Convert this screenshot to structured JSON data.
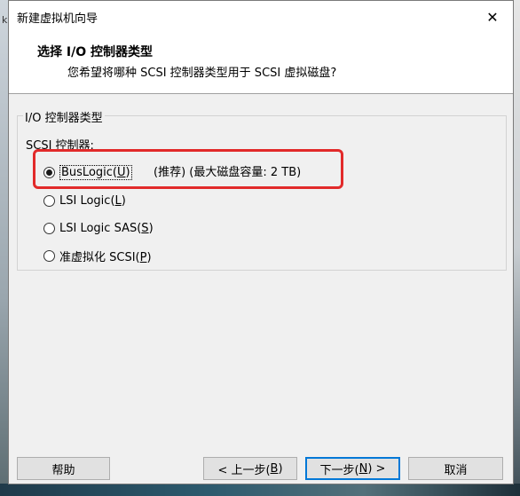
{
  "window": {
    "title": "新建虚拟机向导",
    "close_glyph": "✕"
  },
  "header": {
    "title": "选择 I/O 控制器类型",
    "subtitle": "您希望将哪种 SCSI 控制器类型用于 SCSI 虚拟磁盘?"
  },
  "group": {
    "legend": "I/O 控制器类型",
    "scsi_label": "SCSI 控制器:"
  },
  "options": [
    {
      "label": "BusLogic(",
      "mnemonic": "U",
      "suffix": ")",
      "selected": true
    },
    {
      "label": "LSI Logic(",
      "mnemonic": "L",
      "suffix": ")",
      "selected": false
    },
    {
      "label": "LSI Logic SAS(",
      "mnemonic": "S",
      "suffix": ")",
      "selected": false
    },
    {
      "label": "准虚拟化 SCSI(",
      "mnemonic": "P",
      "suffix": ")",
      "selected": false
    }
  ],
  "recommendation": "(推荐) (最大磁盘容量: 2 TB)",
  "buttons": {
    "help": "帮助",
    "back": {
      "prefix": "< 上一步(",
      "mnemonic": "B",
      "suffix": ")"
    },
    "next": {
      "prefix": "下一步(",
      "mnemonic": "N",
      "suffix": ") >"
    },
    "cancel": "取消"
  },
  "background": {
    "left_chars": "k"
  },
  "colors": {
    "highlight": "#e22a2a",
    "default_button_border": "#0078d7"
  }
}
